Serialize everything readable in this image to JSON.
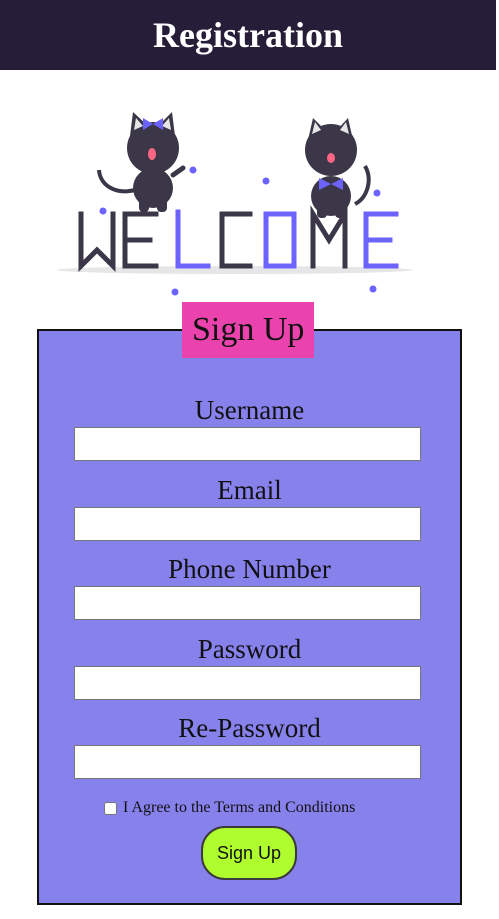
{
  "header": {
    "title": "Registration"
  },
  "illustration": {
    "welcome_text": "WELCOME",
    "colors": {
      "dark": "#3b3748",
      "accent": "#6c63ff",
      "shadow": "#e6e6e6"
    }
  },
  "form": {
    "legend": "Sign Up",
    "fields": [
      {
        "label": "Username",
        "value": "",
        "placeholder": ""
      },
      {
        "label": "Email",
        "value": "",
        "placeholder": ""
      },
      {
        "label": "Phone Number",
        "value": "",
        "placeholder": ""
      },
      {
        "label": "Password",
        "value": "",
        "placeholder": ""
      },
      {
        "label": "Re-Password",
        "value": "",
        "placeholder": ""
      }
    ],
    "agree_label": "I Agree to the Terms and Conditions",
    "agree_checked": false,
    "submit_label": "Sign Up"
  },
  "colors": {
    "header_bg": "#261e38",
    "form_bg": "#8781ec",
    "legend_bg": "#ea43ad",
    "button_bg": "#b0fd2f"
  }
}
